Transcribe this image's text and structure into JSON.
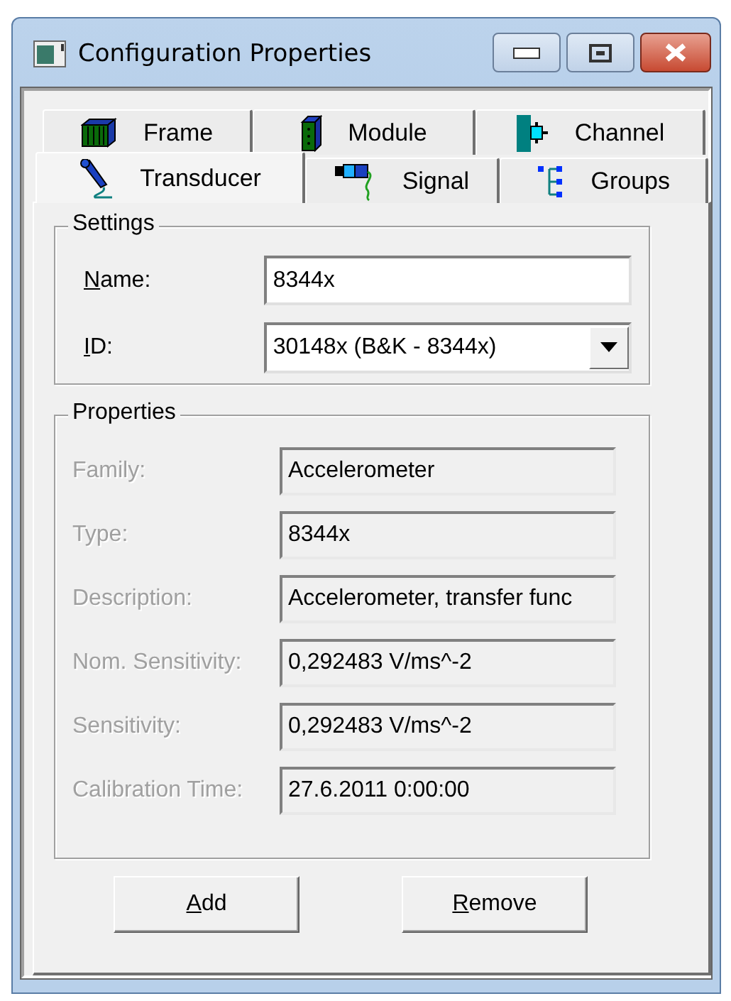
{
  "window": {
    "title": "Configuration Properties"
  },
  "tab_rows": [
    [
      {
        "label": "Frame",
        "selected": false
      },
      {
        "label": "Module",
        "selected": false
      },
      {
        "label": "Channel",
        "selected": false
      }
    ],
    [
      {
        "label": "Transducer",
        "selected": true
      },
      {
        "label": "Signal",
        "selected": false
      },
      {
        "label": "Groups",
        "selected": false
      }
    ]
  ],
  "settings": {
    "title": "Settings",
    "name": {
      "label": "Name:",
      "value": "8344x"
    },
    "id": {
      "label": "ID:",
      "value": "30148x (B&K - 8344x)"
    }
  },
  "properties": {
    "title": "Properties",
    "rows": [
      {
        "label": "Family:",
        "value": "Accelerometer",
        "disabled": true
      },
      {
        "label": "Type:",
        "value": "8344x",
        "disabled": true
      },
      {
        "label": "Description:",
        "value": "Accelerometer, transfer func",
        "disabled": true
      },
      {
        "label": "Nom. Sensitivity:",
        "value": "0,292483 V/ms^-2",
        "disabled": true
      },
      {
        "label": "Sensitivity:",
        "value": "0,292483 V/ms^-2",
        "disabled": true
      },
      {
        "label": "Calibration Time:",
        "value": "27.6.2011 0:00:00",
        "disabled": true
      }
    ]
  },
  "buttons": [
    "Add",
    "Remove"
  ]
}
